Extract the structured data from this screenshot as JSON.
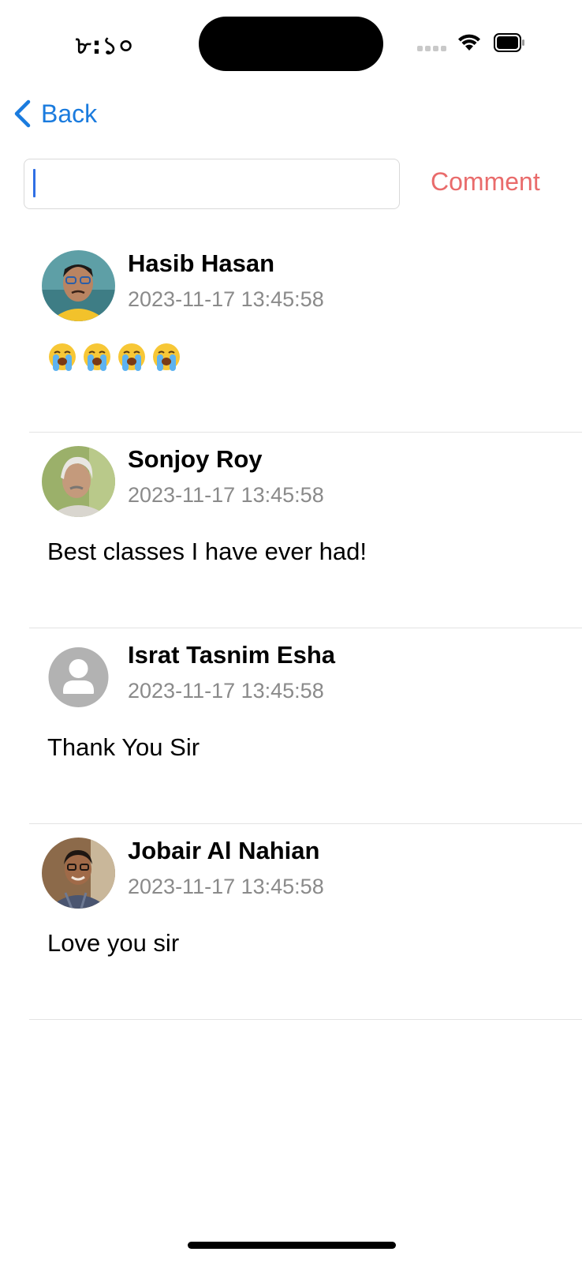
{
  "status_bar": {
    "time": "৮:১০"
  },
  "nav": {
    "back_label": "Back"
  },
  "composer": {
    "value": "",
    "placeholder": "",
    "submit_label": "Comment"
  },
  "comments": [
    {
      "name": "Hasib Hasan",
      "timestamp": "2023-11-17 13:45:58",
      "text": "😭😭😭😭"
    },
    {
      "name": "Sonjoy Roy",
      "timestamp": "2023-11-17 13:45:58",
      "text": "Best classes I have ever had!"
    },
    {
      "name": "Israt Tasnim Esha",
      "timestamp": "2023-11-17 13:45:58",
      "text": "Thank You Sir"
    },
    {
      "name": "Jobair Al Nahian",
      "timestamp": "2023-11-17 13:45:58",
      "text": "Love you sir"
    }
  ],
  "colors": {
    "accent": "#1a7bde",
    "comment_button": "#e96b6b",
    "timestamp": "#8a8a8a"
  }
}
